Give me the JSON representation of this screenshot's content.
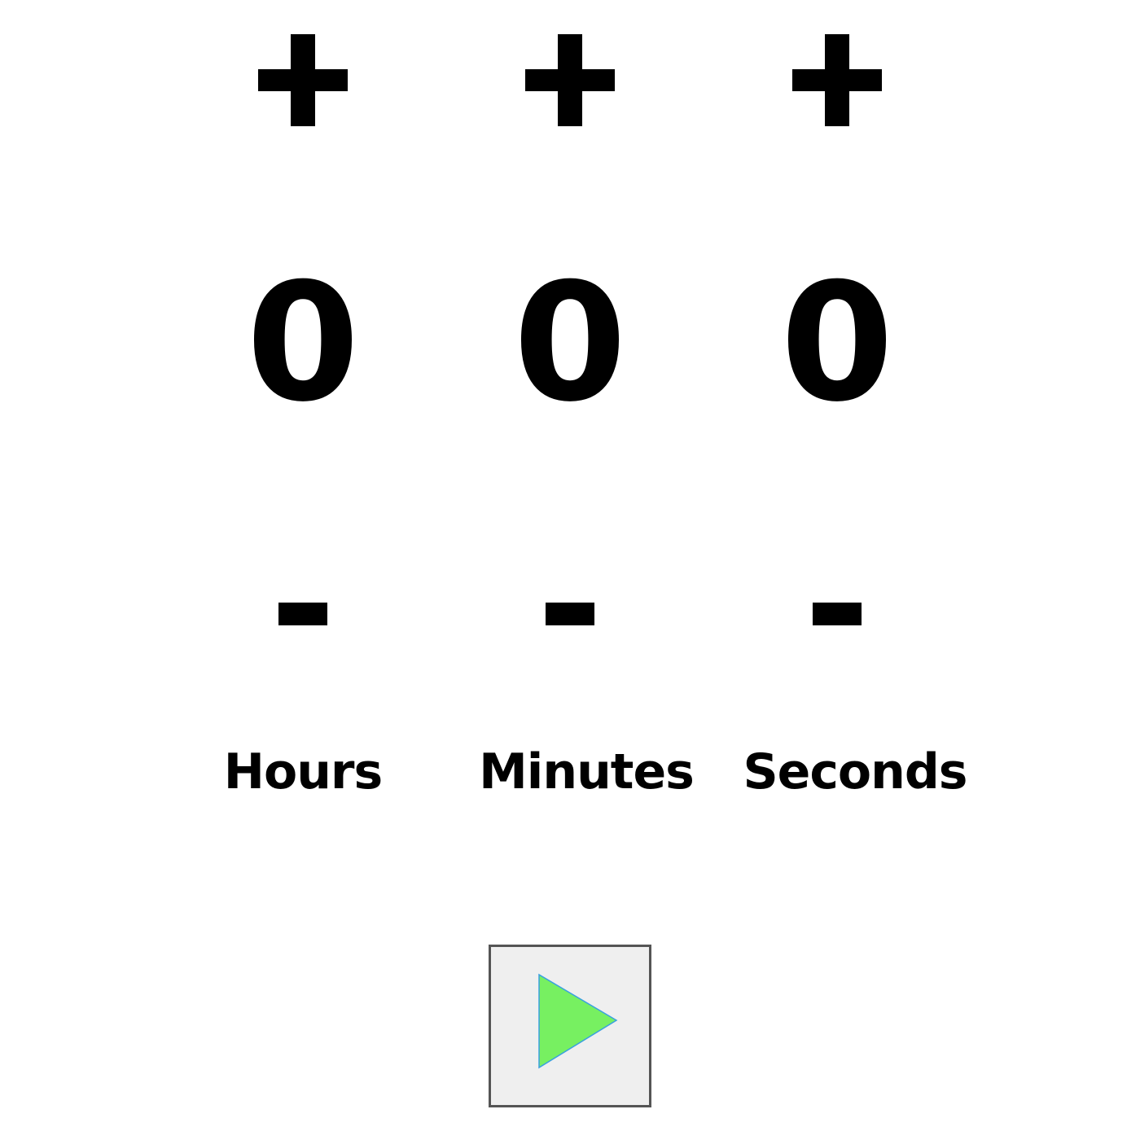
{
  "timer": {
    "units": [
      {
        "key": "hours",
        "label": "Hours",
        "value": "0",
        "increment_symbol": "+",
        "decrement_symbol": "-"
      },
      {
        "key": "minutes",
        "label": "Minutes",
        "value": "0",
        "increment_symbol": "+",
        "decrement_symbol": "-"
      },
      {
        "key": "seconds",
        "label": "Seconds",
        "value": "0",
        "increment_symbol": "+",
        "decrement_symbol": "-"
      }
    ]
  },
  "controls": {
    "play_icon": "play-icon",
    "play_color": "#77f061",
    "play_outline_color": "#3aa0e0"
  },
  "colors": {
    "text": "#000000",
    "background": "#ffffff",
    "button_background": "#efefef",
    "button_border": "#555555"
  }
}
